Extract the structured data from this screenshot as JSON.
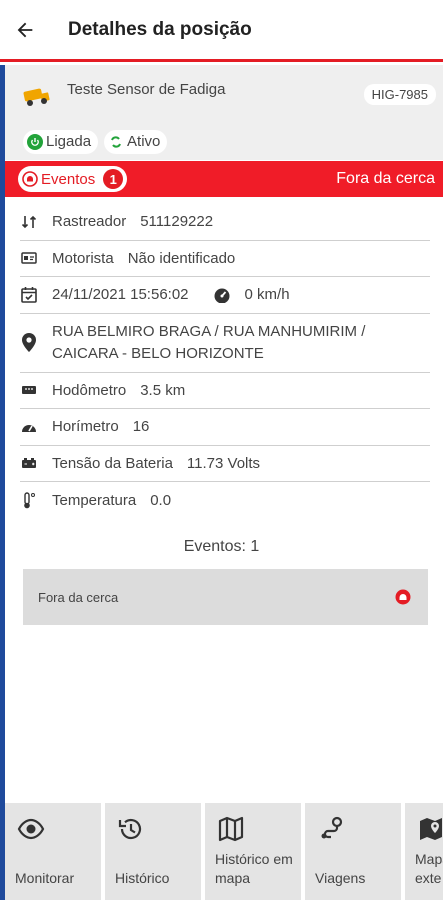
{
  "header": {
    "title": "Detalhes da posição"
  },
  "vehicle": {
    "name": "Teste Sensor de Fadiga",
    "plate": "HIG-7985"
  },
  "status": {
    "ignition": "Ligada",
    "state": "Ativo",
    "ignition_color": "#22a33a"
  },
  "event_bar": {
    "label": "Eventos",
    "count": "1",
    "right_text": "Fora da cerca",
    "color": "#f01c28"
  },
  "info": {
    "tracker_label": "Rastreador",
    "tracker_value": "511129222",
    "driver_label": "Motorista",
    "driver_value": "Não identificado",
    "datetime": "24/11/2021 15:56:02",
    "speed": "0 km/h",
    "address_line1": "RUA BELMIRO BRAGA / RUA MANHUMIRIM /",
    "address_line2": "CAICARA - BELO HORIZONTE",
    "odometer_label": "Hodômetro",
    "odometer_value": "3.5 km",
    "hourmeter_label": "Horímetro",
    "hourmeter_value": "16",
    "battery_label": "Tensão da Bateria",
    "battery_value": "11.73 Volts",
    "temperature_label": "Temperatura",
    "temperature_value": "0.0"
  },
  "events": {
    "title": "Eventos: 1",
    "items": [
      {
        "label": "Fora da cerca"
      }
    ]
  },
  "bottom_nav": [
    {
      "label": "Monitorar",
      "icon": "eye-icon"
    },
    {
      "label": "Histórico",
      "icon": "history-icon"
    },
    {
      "label": "Histórico em mapa",
      "icon": "map-icon"
    },
    {
      "label": "Viagens",
      "icon": "route-icon"
    },
    {
      "label": "Mapa exte",
      "icon": "map-pin-icon"
    }
  ]
}
